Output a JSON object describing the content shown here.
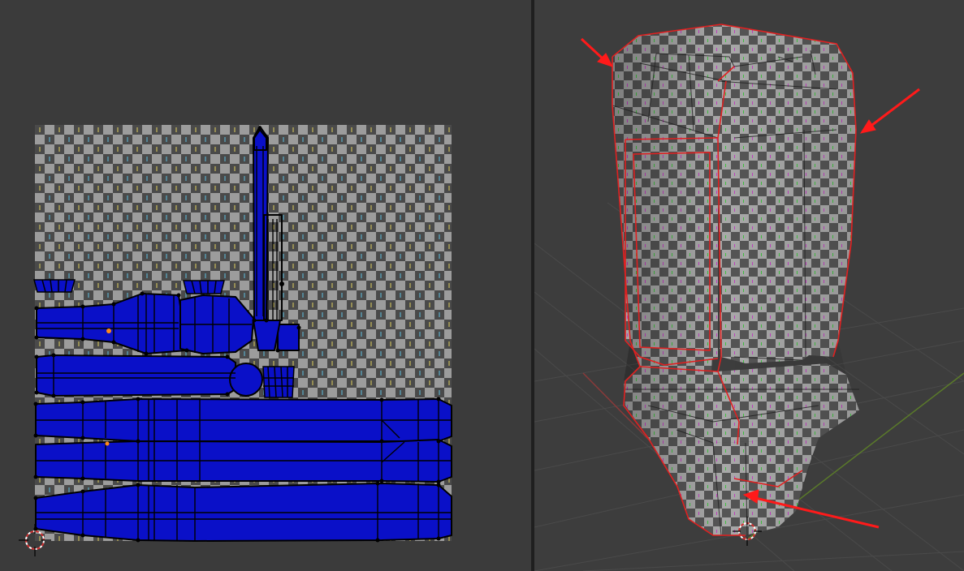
{
  "colors": {
    "background": "#3a3a3a",
    "editor_divider": "#1f1f1f",
    "uv_island_fill": "#0a10c8",
    "uv_edges": "#000000",
    "checker_light": "#9c9c9c",
    "checker_dark": "#4a4a4a",
    "seam_highlight": "#e02020",
    "annotation_arrow": "#ff1a1a",
    "grid_x_axis": "#8a3a3a",
    "grid_y_axis": "#5a7a2a"
  },
  "editors": {
    "uv": {
      "icon": "3d-cursor-icon",
      "texture": "uv-checker-grid",
      "selection": "all-uv-islands-selected"
    },
    "viewport": {
      "icon": "3d-cursor-icon",
      "object": "checker-textured-handle-mesh",
      "annotations": [
        "arrow-top-left",
        "arrow-top-right",
        "arrow-bottom"
      ]
    }
  }
}
